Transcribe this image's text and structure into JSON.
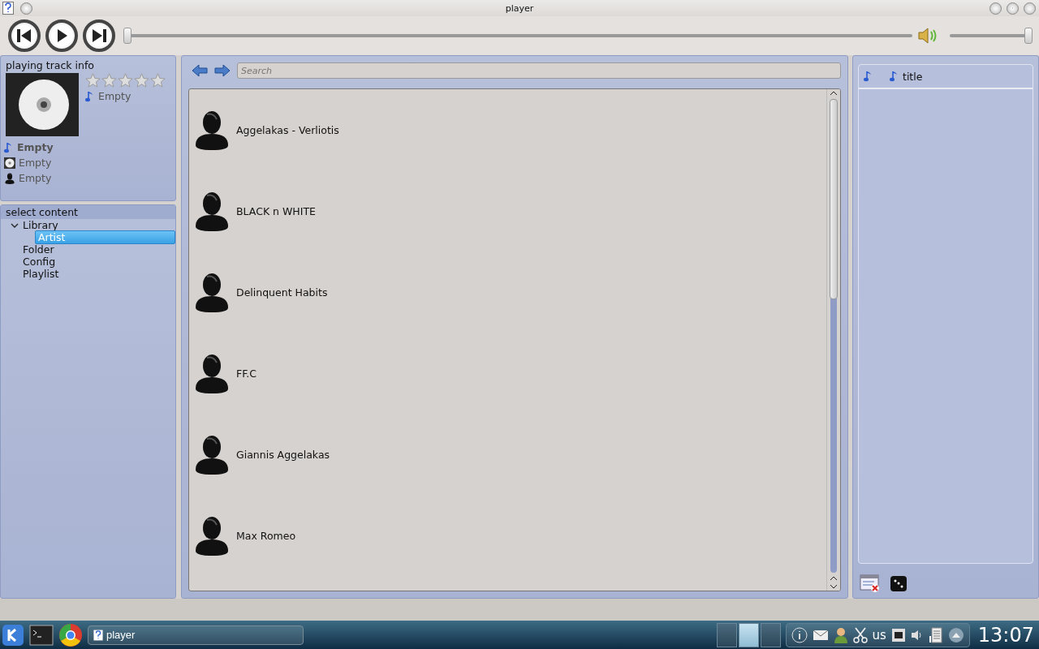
{
  "window": {
    "title": "player"
  },
  "transport": {
    "position": {
      "level": 0
    },
    "volume": {
      "level": 1
    }
  },
  "track_info": {
    "title": "playing track info",
    "rating": {
      "stars": 0
    },
    "side_text": "Empty",
    "track": "Empty",
    "album": "Empty",
    "artist": "Empty"
  },
  "select_content": {
    "title": "select content",
    "tree": [
      {
        "label": "Library",
        "expanded": true,
        "selected": false,
        "children": [
          {
            "label": "Artist",
            "selected": true
          }
        ]
      },
      {
        "label": "Folder",
        "selected": false
      },
      {
        "label": "Config",
        "selected": false
      },
      {
        "label": "Playlist",
        "selected": false
      }
    ]
  },
  "browser": {
    "search": {
      "placeholder": "Search"
    },
    "artists": [
      {
        "name": "Aggelakas - Verliotis"
      },
      {
        "name": "BLACK n WHITE"
      },
      {
        "name": "Delinquent Habits"
      },
      {
        "name": "FF.C"
      },
      {
        "name": "Giannis Aggelakas"
      },
      {
        "name": "Max Romeo"
      }
    ]
  },
  "playlist": {
    "columns": [
      "title"
    ]
  },
  "taskbar": {
    "tasks": [
      {
        "label": "player"
      }
    ],
    "keyboard_layout": "us",
    "clock": "13:07"
  }
}
